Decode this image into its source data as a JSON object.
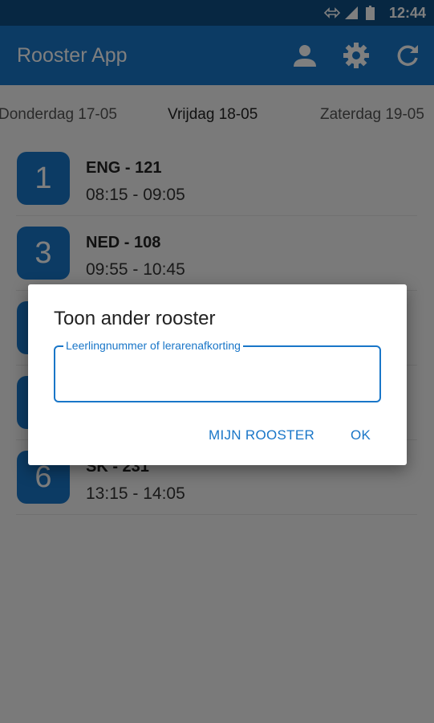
{
  "statusbar": {
    "time": "12:44"
  },
  "appbar": {
    "title": "Rooster App"
  },
  "days": {
    "prev": "Donderdag 17-05",
    "current": "Vrijdag 18-05",
    "next": "Zaterdag 19-05"
  },
  "lessons": [
    {
      "hour": "1",
      "name": "ENG - 121",
      "time": "08:15 - 09:05"
    },
    {
      "hour": "3",
      "name": "NED - 108",
      "time": "09:55 - 10:45"
    },
    {
      "hour": "",
      "name": "",
      "time": ""
    },
    {
      "hour": "",
      "name": "",
      "time": ""
    },
    {
      "hour": "6",
      "name": "SK - 231",
      "time": "13:15 - 14:05"
    }
  ],
  "dialog": {
    "title": "Toon ander rooster",
    "field_label": "Leerlingnummer of lerarenafkorting",
    "field_value": "",
    "my_schedule_button": "MIJN ROOSTER",
    "ok_button": "OK"
  },
  "colors": {
    "primary": "#1976c8",
    "status": "#0f4f85"
  }
}
